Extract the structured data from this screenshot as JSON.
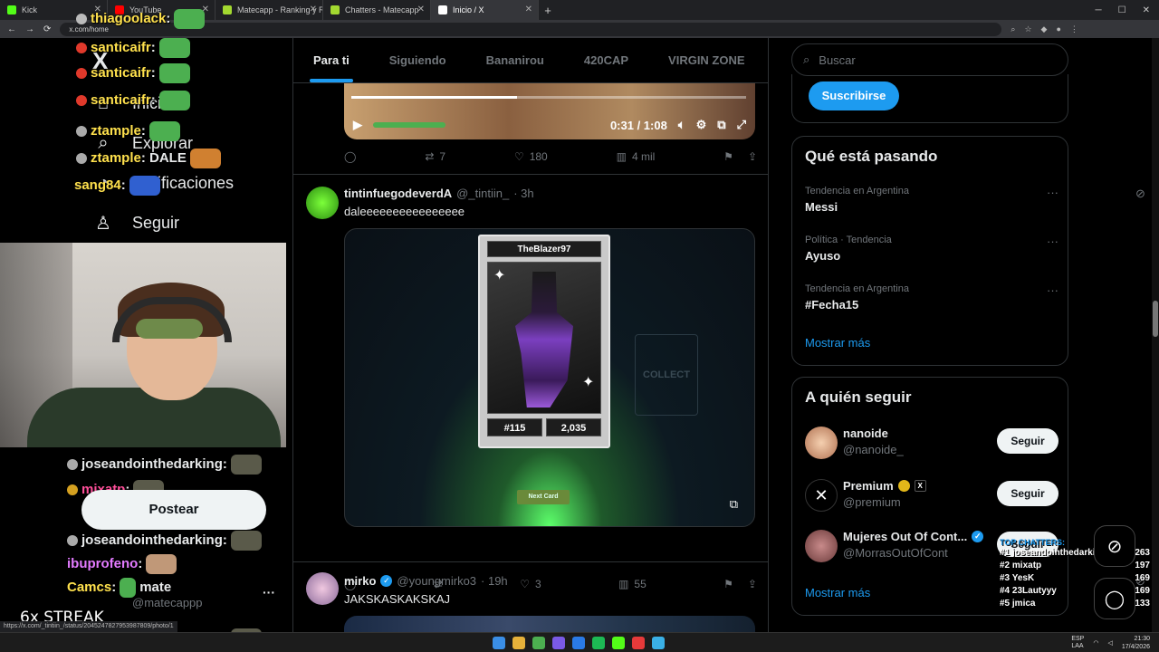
{
  "browser": {
    "tabs": [
      {
        "label": "Kick",
        "color": "#53fc18",
        "active": false
      },
      {
        "label": "YouTube",
        "color": "#ff0000",
        "active": false
      },
      {
        "label": "Matecapp - Ranking y Racha d",
        "color": "#a3d930",
        "active": false
      },
      {
        "label": "Chatters - Matecapp",
        "color": "#a3d930",
        "active": false
      },
      {
        "label": "Inicio / X",
        "color": "#ffffff",
        "active": true
      }
    ],
    "url": "x.com/home",
    "status_url": "https://x.com/_tintiin_/status/2045247827953987809/photo/1"
  },
  "nav": {
    "logo": "X",
    "items": [
      {
        "label": "Inicio",
        "icon": "home-icon"
      },
      {
        "label": "Explorar",
        "icon": "search-icon"
      },
      {
        "label": "Notificaciones",
        "icon": "bell-icon"
      },
      {
        "label": "Seguir",
        "icon": "add-user-icon"
      },
      {
        "label": "Más opciones",
        "icon": "more-circle-icon"
      }
    ],
    "post_button": "Postear",
    "account_name": "mate",
    "account_handle": "@matecappp"
  },
  "feed": {
    "tabs": [
      "Para ti",
      "Siguiendo",
      "Bananirou",
      "420CAP",
      "VIRGIN ZONE"
    ],
    "active_tab": "Para ti",
    "video": {
      "time": "0:31 / 1:08",
      "progress": 0.42
    },
    "first_tweet_actions": {
      "reply": "",
      "retweet": "7",
      "like": "180",
      "views": "4 mil"
    },
    "tweets": [
      {
        "name": "tintinfuegodeverdA",
        "handle": "@_tintiin_",
        "time": "· 3h",
        "text": "daleeeeeeeeeeeeeeee",
        "card": {
          "title": "TheBlazer97",
          "number": "#115",
          "score": "2,035",
          "next": "Next Card",
          "ghost": "COLLECT"
        },
        "actions": {
          "reply": "",
          "retweet": "",
          "like": "3",
          "views": "55"
        }
      },
      {
        "name": "mirko",
        "handle": "@youngmirko3",
        "time": "· 19h",
        "text": "JAKSKASKAKSKAJ",
        "verified": true
      }
    ]
  },
  "sidebar": {
    "search_placeholder": "Buscar",
    "subscribe_label": "Suscribirse",
    "trends_title": "Qué está pasando",
    "trends": [
      {
        "meta": "Tendencia en Argentina",
        "topic": "Messi"
      },
      {
        "meta": "Política · Tendencia",
        "topic": "Ayuso"
      },
      {
        "meta": "Tendencia en Argentina",
        "topic": "#Fecha15"
      }
    ],
    "show_more": "Mostrar más",
    "follow_title": "A quién seguir",
    "follow": [
      {
        "name": "nanoide",
        "handle": "@nanoide_",
        "button": "Seguir"
      },
      {
        "name": "Premium",
        "handle": "@premium",
        "button": "Seguir"
      },
      {
        "name": "Mujeres Out Of Cont...",
        "handle": "@MorrasOutOfCont",
        "button": "Seguir"
      }
    ]
  },
  "stream": {
    "chat": [
      {
        "user": "thiagoolack",
        "text": ":",
        "color": "#ffe14d"
      },
      {
        "user": "santicaifr",
        "text": ":",
        "color": "#ffe14d"
      },
      {
        "user": "santicaifr",
        "text": ":",
        "color": "#ffe14d"
      },
      {
        "user": "santicaifr",
        "text": ":",
        "color": "#ffe14d"
      },
      {
        "user": "ztample",
        "text": ":",
        "color": "#ffe14d"
      },
      {
        "user": "ztample",
        "text": ": DALE",
        "color": "#ffe14d"
      },
      {
        "user": "sang84",
        "text": ":",
        "color": "#ffe14d"
      },
      {
        "user": "joseandointhedarking",
        "text": ":",
        "color": "#ffffff"
      },
      {
        "user": "mixatp",
        "text": ":",
        "color": "#ff4f9a"
      },
      {
        "user": "joseandointhedarking",
        "text": ":",
        "color": "#ffffff"
      },
      {
        "user": "joseandointhedarking",
        "text": ":",
        "color": "#ffffff"
      },
      {
        "user": "ibuprofeno",
        "text": ":",
        "color": "#e37bff"
      },
      {
        "user": "Camcs",
        "text": ":",
        "color": "#ffe14d"
      },
      {
        "user": "ibuprofeno",
        "text": ":",
        "color": "#e37bff"
      },
      {
        "user": "joseandointhedarking",
        "text": ":",
        "color": "#ffffff"
      }
    ],
    "streak": "6x STREAK",
    "leaderboard_title": "TOP CHATTERS:",
    "leaderboard": [
      {
        "rank": "#1 joseandointhedarking",
        "count": "263"
      },
      {
        "rank": "#2 mixatp",
        "count": "197"
      },
      {
        "rank": "#3 YesK",
        "count": "169"
      },
      {
        "rank": "#4 23Lautyyy",
        "count": "169"
      },
      {
        "rank": "#5 jmica",
        "count": "133"
      }
    ]
  },
  "taskbar": {
    "lang": "ESP\nLAA",
    "time": "21:30",
    "date": "17/4/2026"
  }
}
